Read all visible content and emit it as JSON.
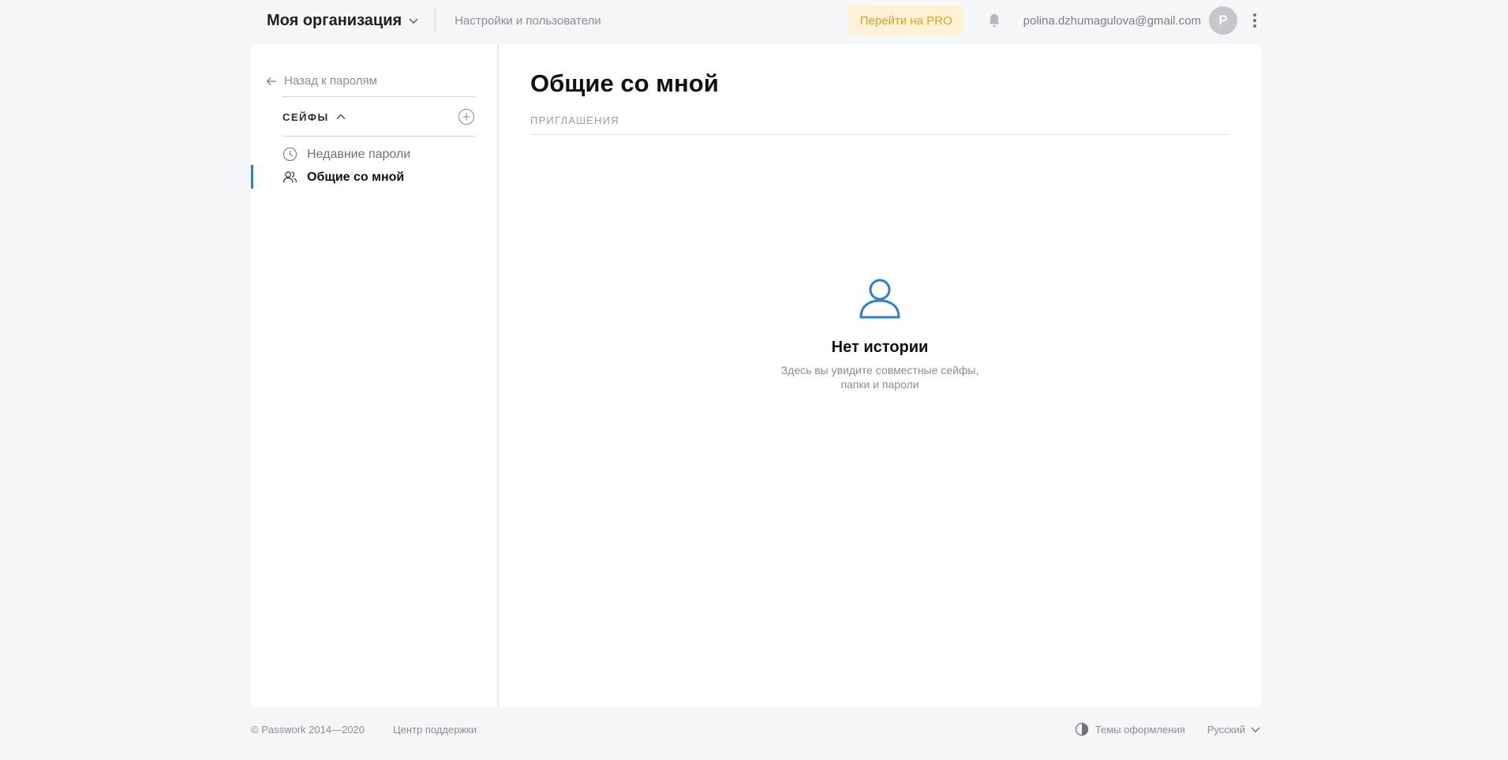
{
  "header": {
    "org_name": "Моя организация",
    "settings_link": "Настройки и пользователи",
    "pro_button": "Перейти на PRO",
    "user_email": "polina.dzhumagulova@gmail.com",
    "avatar_letter": "P"
  },
  "sidebar": {
    "back_label": "Назад к паролям",
    "safes_label": "СЕЙФЫ",
    "items": [
      {
        "label": "Недавние пароли",
        "icon": "clock-icon",
        "active": false
      },
      {
        "label": "Общие со мной",
        "icon": "users-icon",
        "active": true
      }
    ]
  },
  "main": {
    "title": "Общие со мной",
    "tab_invites": "ПРИГЛАШЕНИЯ",
    "empty_title": "Нет истории",
    "empty_desc_line1": "Здесь вы увидите совместные сейфы,",
    "empty_desc_line2": "папки и пароли"
  },
  "footer": {
    "copyright": "© Passwork 2014—2020",
    "support": "Центр поддержки",
    "themes": "Темы оформления",
    "language": "Русский"
  },
  "colors": {
    "accent": "#2f7fd1",
    "pro_bg": "#fdf1d6",
    "pro_text": "#e0a020",
    "page_bg": "#f5f6f8"
  }
}
